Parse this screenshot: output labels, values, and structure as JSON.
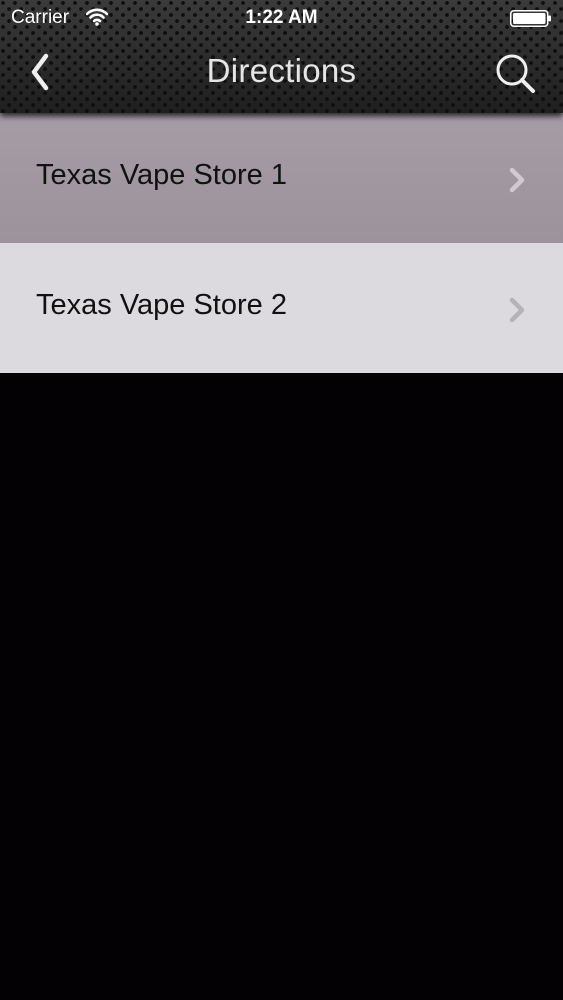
{
  "status_bar": {
    "carrier": "Carrier",
    "time": "1:22 AM",
    "wifi_icon": "wifi-icon",
    "battery_icon": "battery-icon"
  },
  "nav": {
    "title": "Directions",
    "back_icon": "chevron-left-icon",
    "search_icon": "search-icon"
  },
  "list": {
    "items": [
      {
        "label": "Texas Vape Store 1",
        "selected": true,
        "icon": "chevron-right-icon"
      },
      {
        "label": "Texas Vape Store 2",
        "selected": false,
        "icon": "chevron-right-icon"
      }
    ]
  },
  "colors": {
    "selected_row": "#a29aa2",
    "normal_row": "#dcdadf",
    "background": "#030103",
    "title_text": "#e6e6e6",
    "chevron_selected": "#d0cad0",
    "chevron_normal": "#b5b3b8"
  }
}
